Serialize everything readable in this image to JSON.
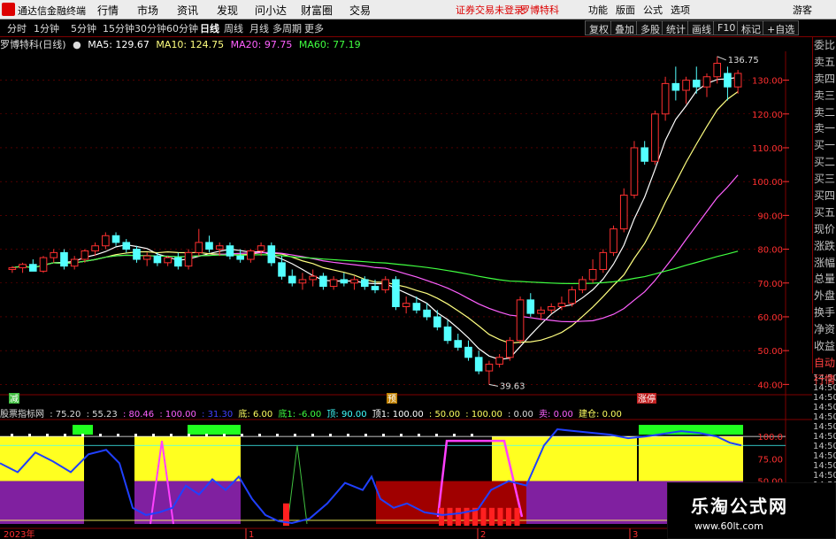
{
  "topbar": {
    "app_name": "通达信金融终端",
    "menus": [
      "行情",
      "市场",
      "资讯",
      "发现",
      "问小达",
      "财富圈",
      "交易"
    ],
    "red_labels": [
      "证券交易未登录",
      "罗博特科"
    ],
    "right_menus": [
      "功能",
      "版面",
      "公式",
      "选项"
    ],
    "guest": "游客"
  },
  "periods": [
    "分时",
    "1分钟",
    "5分钟",
    "15分钟",
    "30分钟",
    "60分钟",
    "日线",
    "周线",
    "月线",
    "多周期",
    "更多"
  ],
  "active_period": "日线",
  "tools": [
    "复权",
    "叠加",
    "多股",
    "统计",
    "画线",
    "F10",
    "标记",
    "+自选"
  ],
  "info": {
    "stock": "罗博特科(日线)",
    "ma5": "MA5: 129.67",
    "ma10": "MA10: 124.75",
    "ma20": "MA20: 97.75",
    "ma60": "MA60: 77.19"
  },
  "colors": {
    "up": "#ff3030",
    "down": "#54ffff",
    "ma5": "#ffffff",
    "ma10": "#ffff80",
    "ma20": "#ff60ff",
    "ma60": "#40ff40",
    "grid": "#800000"
  },
  "price_axis": [
    "130.00",
    "120.00",
    "110.00",
    "100.00",
    "90.00",
    "80.00",
    "70.00",
    "60.00",
    "50.00",
    "40.00"
  ],
  "annotations": {
    "high": "136.75",
    "low": "39.63"
  },
  "markers": [
    "减",
    "预",
    "涨停"
  ],
  "indicator": {
    "title": "股票指标网",
    "values": [
      ": 75.20",
      ": 55.23",
      ": 80.46",
      ": 100.00",
      ": 31.30",
      "底: 6.00",
      "底1: -6.00",
      "顶: 90.00",
      "顶1: 100.00",
      ": 50.00",
      ": 100.00",
      ": 0.00",
      "卖: 0.00",
      "建仓: 0.00"
    ],
    "axis": [
      "100.0",
      "75.00",
      "50.00"
    ]
  },
  "time_axis": {
    "year": "2023年",
    "marks": [
      "1",
      "2",
      "3"
    ]
  },
  "time_labels": [
    "14:50",
    "14:50",
    "14:50",
    "14:50",
    "14:50",
    "14:50",
    "14:50",
    "14:50",
    "14:50",
    "14:50",
    "14:50",
    "14:50",
    "14:50",
    "14:50",
    "14:50",
    "14:50"
  ],
  "right_panel": [
    "委比",
    "卖五",
    "卖四",
    "卖三",
    "卖二",
    "卖一",
    "买一",
    "买二",
    "买三",
    "买四",
    "买五",
    "现价",
    "涨跌",
    "涨幅",
    "总量",
    "外盘",
    "换手",
    "净资",
    "收益",
    "自动",
    "行情"
  ],
  "watermark": {
    "line1": "乐淘公式网",
    "line2": "www.60lt.com"
  },
  "chart_data": {
    "type": "candlestick",
    "y_range": [
      38,
      138
    ],
    "candles": [
      [
        74,
        75,
        73,
        74.5
      ],
      [
        74.5,
        76,
        73,
        75.5
      ],
      [
        75.5,
        77,
        74,
        73.5
      ],
      [
        73.5,
        78,
        73,
        77.5
      ],
      [
        77.5,
        80,
        76,
        79
      ],
      [
        79,
        80,
        74,
        75
      ],
      [
        75,
        78,
        74,
        77
      ],
      [
        77,
        80,
        76,
        79.5
      ],
      [
        79.5,
        82,
        78,
        81
      ],
      [
        81,
        85,
        80,
        84
      ],
      [
        84,
        85,
        81,
        82
      ],
      [
        82,
        83,
        79,
        80
      ],
      [
        80,
        81,
        76,
        77
      ],
      [
        77,
        79,
        75,
        78
      ],
      [
        78,
        79,
        75,
        76
      ],
      [
        76,
        78,
        75,
        77.5
      ],
      [
        77.5,
        79,
        74,
        75
      ],
      [
        75,
        80,
        74,
        79
      ],
      [
        79,
        86,
        78,
        82
      ],
      [
        82,
        84,
        79,
        80
      ],
      [
        80,
        82,
        78,
        81
      ],
      [
        81,
        82,
        77,
        78
      ],
      [
        78,
        80,
        76,
        77
      ],
      [
        77,
        80,
        76,
        79.5
      ],
      [
        79.5,
        82,
        78,
        81
      ],
      [
        81,
        82,
        75,
        76
      ],
      [
        76,
        78,
        71,
        72
      ],
      [
        72,
        74,
        69,
        70
      ],
      [
        70,
        73,
        68,
        71
      ],
      [
        71,
        74,
        69,
        72
      ],
      [
        72,
        73,
        68,
        69
      ],
      [
        69,
        72,
        68,
        71
      ],
      [
        71,
        73,
        69,
        70
      ],
      [
        70,
        72,
        68,
        71
      ],
      [
        71,
        72,
        68,
        69
      ],
      [
        69,
        71,
        67,
        68
      ],
      [
        68,
        72,
        67,
        71
      ],
      [
        71,
        72,
        62,
        63
      ],
      [
        63,
        66,
        61,
        64
      ],
      [
        64,
        66,
        61,
        62
      ],
      [
        62,
        64,
        59,
        60
      ],
      [
        60,
        62,
        56,
        57
      ],
      [
        57,
        59,
        52,
        53
      ],
      [
        53,
        55,
        50,
        51
      ],
      [
        51,
        53,
        47,
        48
      ],
      [
        48,
        50,
        43,
        44
      ],
      [
        44,
        47,
        40,
        46
      ],
      [
        46,
        49,
        45,
        48
      ],
      [
        48,
        54,
        47,
        53
      ],
      [
        53,
        66,
        52,
        65
      ],
      [
        65,
        67,
        60,
        61
      ],
      [
        61,
        63,
        59,
        62
      ],
      [
        62,
        64,
        61,
        63
      ],
      [
        63,
        66,
        62,
        64
      ],
      [
        64,
        69,
        63,
        68
      ],
      [
        68,
        72,
        67,
        71
      ],
      [
        71,
        77,
        70,
        74
      ],
      [
        74,
        80,
        73,
        79
      ],
      [
        79,
        87,
        78,
        86
      ],
      [
        86,
        98,
        85,
        96
      ],
      [
        96,
        112,
        95,
        110
      ],
      [
        110,
        112,
        105,
        106
      ],
      [
        106,
        121,
        105,
        120
      ],
      [
        120,
        131,
        118,
        129
      ],
      [
        129,
        134,
        124,
        127
      ],
      [
        127,
        131,
        123,
        130
      ],
      [
        130,
        134,
        126,
        128
      ],
      [
        128,
        132,
        125,
        131
      ],
      [
        131,
        137,
        129,
        135
      ],
      [
        132,
        134,
        124,
        128
      ],
      [
        128,
        133,
        126,
        132
      ]
    ]
  }
}
